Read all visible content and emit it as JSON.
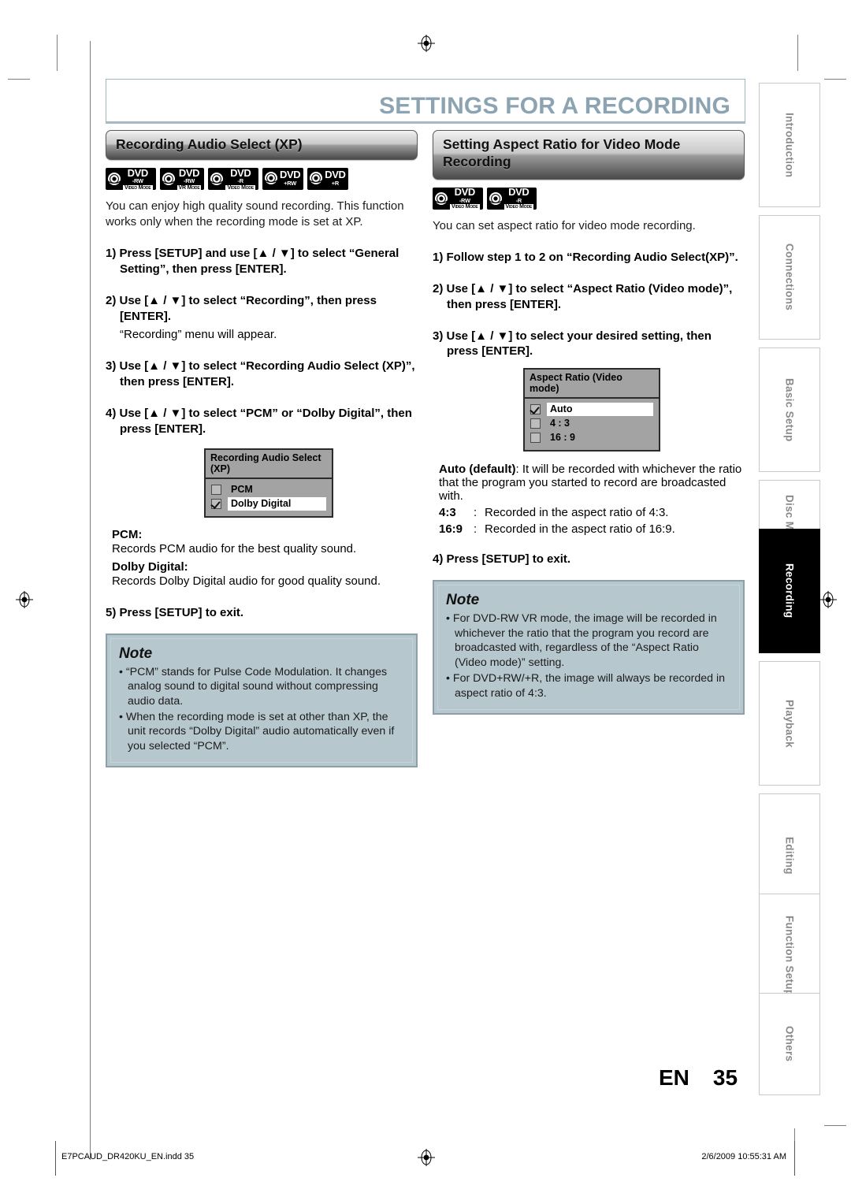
{
  "header": {
    "chapter_title": "SETTINGS FOR A RECORDING"
  },
  "left_column": {
    "section_title": "Recording Audio Select (XP)",
    "badges": [
      {
        "name": "DVD",
        "line2": "-RW",
        "line3": "Video Mode"
      },
      {
        "name": "DVD",
        "line2": "-RW",
        "line3": "VR Mode"
      },
      {
        "name": "DVD",
        "line2": "-R",
        "line3": "Video Mode"
      },
      {
        "name": "DVD",
        "line2": "+RW",
        "line3": ""
      },
      {
        "name": "DVD",
        "line2": "+R",
        "line3": ""
      }
    ],
    "intro": "You can enjoy high quality sound recording. This function works only when the recording mode is set at XP.",
    "steps": [
      {
        "text": "1) Press [SETUP] and use [▲ / ▼] to select “General Setting”, then press [ENTER]."
      },
      {
        "text": "2) Use [▲ / ▼] to select “Recording”, then press [ENTER].",
        "sub": "“Recording” menu will appear."
      },
      {
        "text": "3) Use [▲ / ▼] to select “Recording Audio Select (XP)”, then press [ENTER]."
      },
      {
        "text": "4) Use [▲ / ▼] to select “PCM” or “Dolby Digital”, then press [ENTER]."
      }
    ],
    "osd": {
      "title": "Recording Audio Select (XP)",
      "rows": [
        {
          "label": "PCM",
          "checked": false,
          "highlighted": false
        },
        {
          "label": "Dolby Digital",
          "checked": true,
          "highlighted": true
        }
      ]
    },
    "definitions": [
      {
        "term": "PCM:",
        "desc": "Records PCM audio for the best quality sound."
      },
      {
        "term": "Dolby Digital:",
        "desc": "Records Dolby Digital audio for good quality sound."
      }
    ],
    "final_step": "5) Press [SETUP] to exit.",
    "note": {
      "heading": "Note",
      "items": [
        "“PCM” stands for Pulse Code Modulation. It changes analog sound to digital sound without compressing audio data.",
        "When the recording mode is set at other than XP, the unit records “Dolby Digital” audio automatically even if you selected “PCM”."
      ]
    }
  },
  "right_column": {
    "section_title": "Setting Aspect Ratio for Video Mode Recording",
    "badges": [
      {
        "name": "DVD",
        "line2": "-RW",
        "line3": "Video Mode"
      },
      {
        "name": "DVD",
        "line2": "-R",
        "line3": "Video Mode"
      }
    ],
    "intro": "You can set aspect ratio for video mode recording.",
    "steps": [
      {
        "text": "1) Follow step 1 to 2 on “Recording Audio Select(XP)”."
      },
      {
        "text": "2) Use [▲ / ▼] to select “Aspect Ratio (Video mode)”, then press [ENTER]."
      },
      {
        "text": "3) Use [▲ / ▼] to select your desired setting, then press [ENTER]."
      }
    ],
    "osd": {
      "title": "Aspect Ratio (Video mode)",
      "rows": [
        {
          "label": "Auto",
          "checked": true,
          "highlighted": true
        },
        {
          "label": "4 : 3",
          "checked": false,
          "highlighted": false
        },
        {
          "label": "16 : 9",
          "checked": false,
          "highlighted": false
        }
      ]
    },
    "auto_definition": {
      "term": "Auto (default)",
      "desc": ": It will be recorded with whichever the ratio that the program you started to record are broadcasted with."
    },
    "ratio_rows": [
      {
        "key": "4:3",
        "sep": ":",
        "desc": "Recorded in the aspect ratio of 4:3."
      },
      {
        "key": "16:9",
        "sep": ":",
        "desc": "Recorded in the aspect ratio of 16:9."
      }
    ],
    "final_step": "4) Press [SETUP] to exit.",
    "note": {
      "heading": "Note",
      "items": [
        "For DVD-RW VR mode, the image will be recorded in whichever the ratio that the program you record are broadcasted with, regardless of the “Aspect Ratio (Video mode)” setting.",
        "For DVD+RW/+R, the image will always be recorded in aspect ratio of 4:3."
      ]
    }
  },
  "side_tabs": [
    {
      "label": "Introduction",
      "active": false
    },
    {
      "label": "Connections",
      "active": false
    },
    {
      "label": "Basic Setup",
      "active": false
    },
    {
      "label": "Disc Management",
      "active": false
    },
    {
      "label": "Recording",
      "active": true
    },
    {
      "label": "Playback",
      "active": false
    },
    {
      "label": "Editing",
      "active": false
    },
    {
      "label": "Function Setup",
      "active": false
    },
    {
      "label": "Others",
      "active": false
    }
  ],
  "page_number": {
    "lang": "EN",
    "number": "35"
  },
  "footer": {
    "left": "E7PCAUD_DR420KU_EN.indd   35",
    "right": "2/6/2009   10:55:31 AM"
  }
}
